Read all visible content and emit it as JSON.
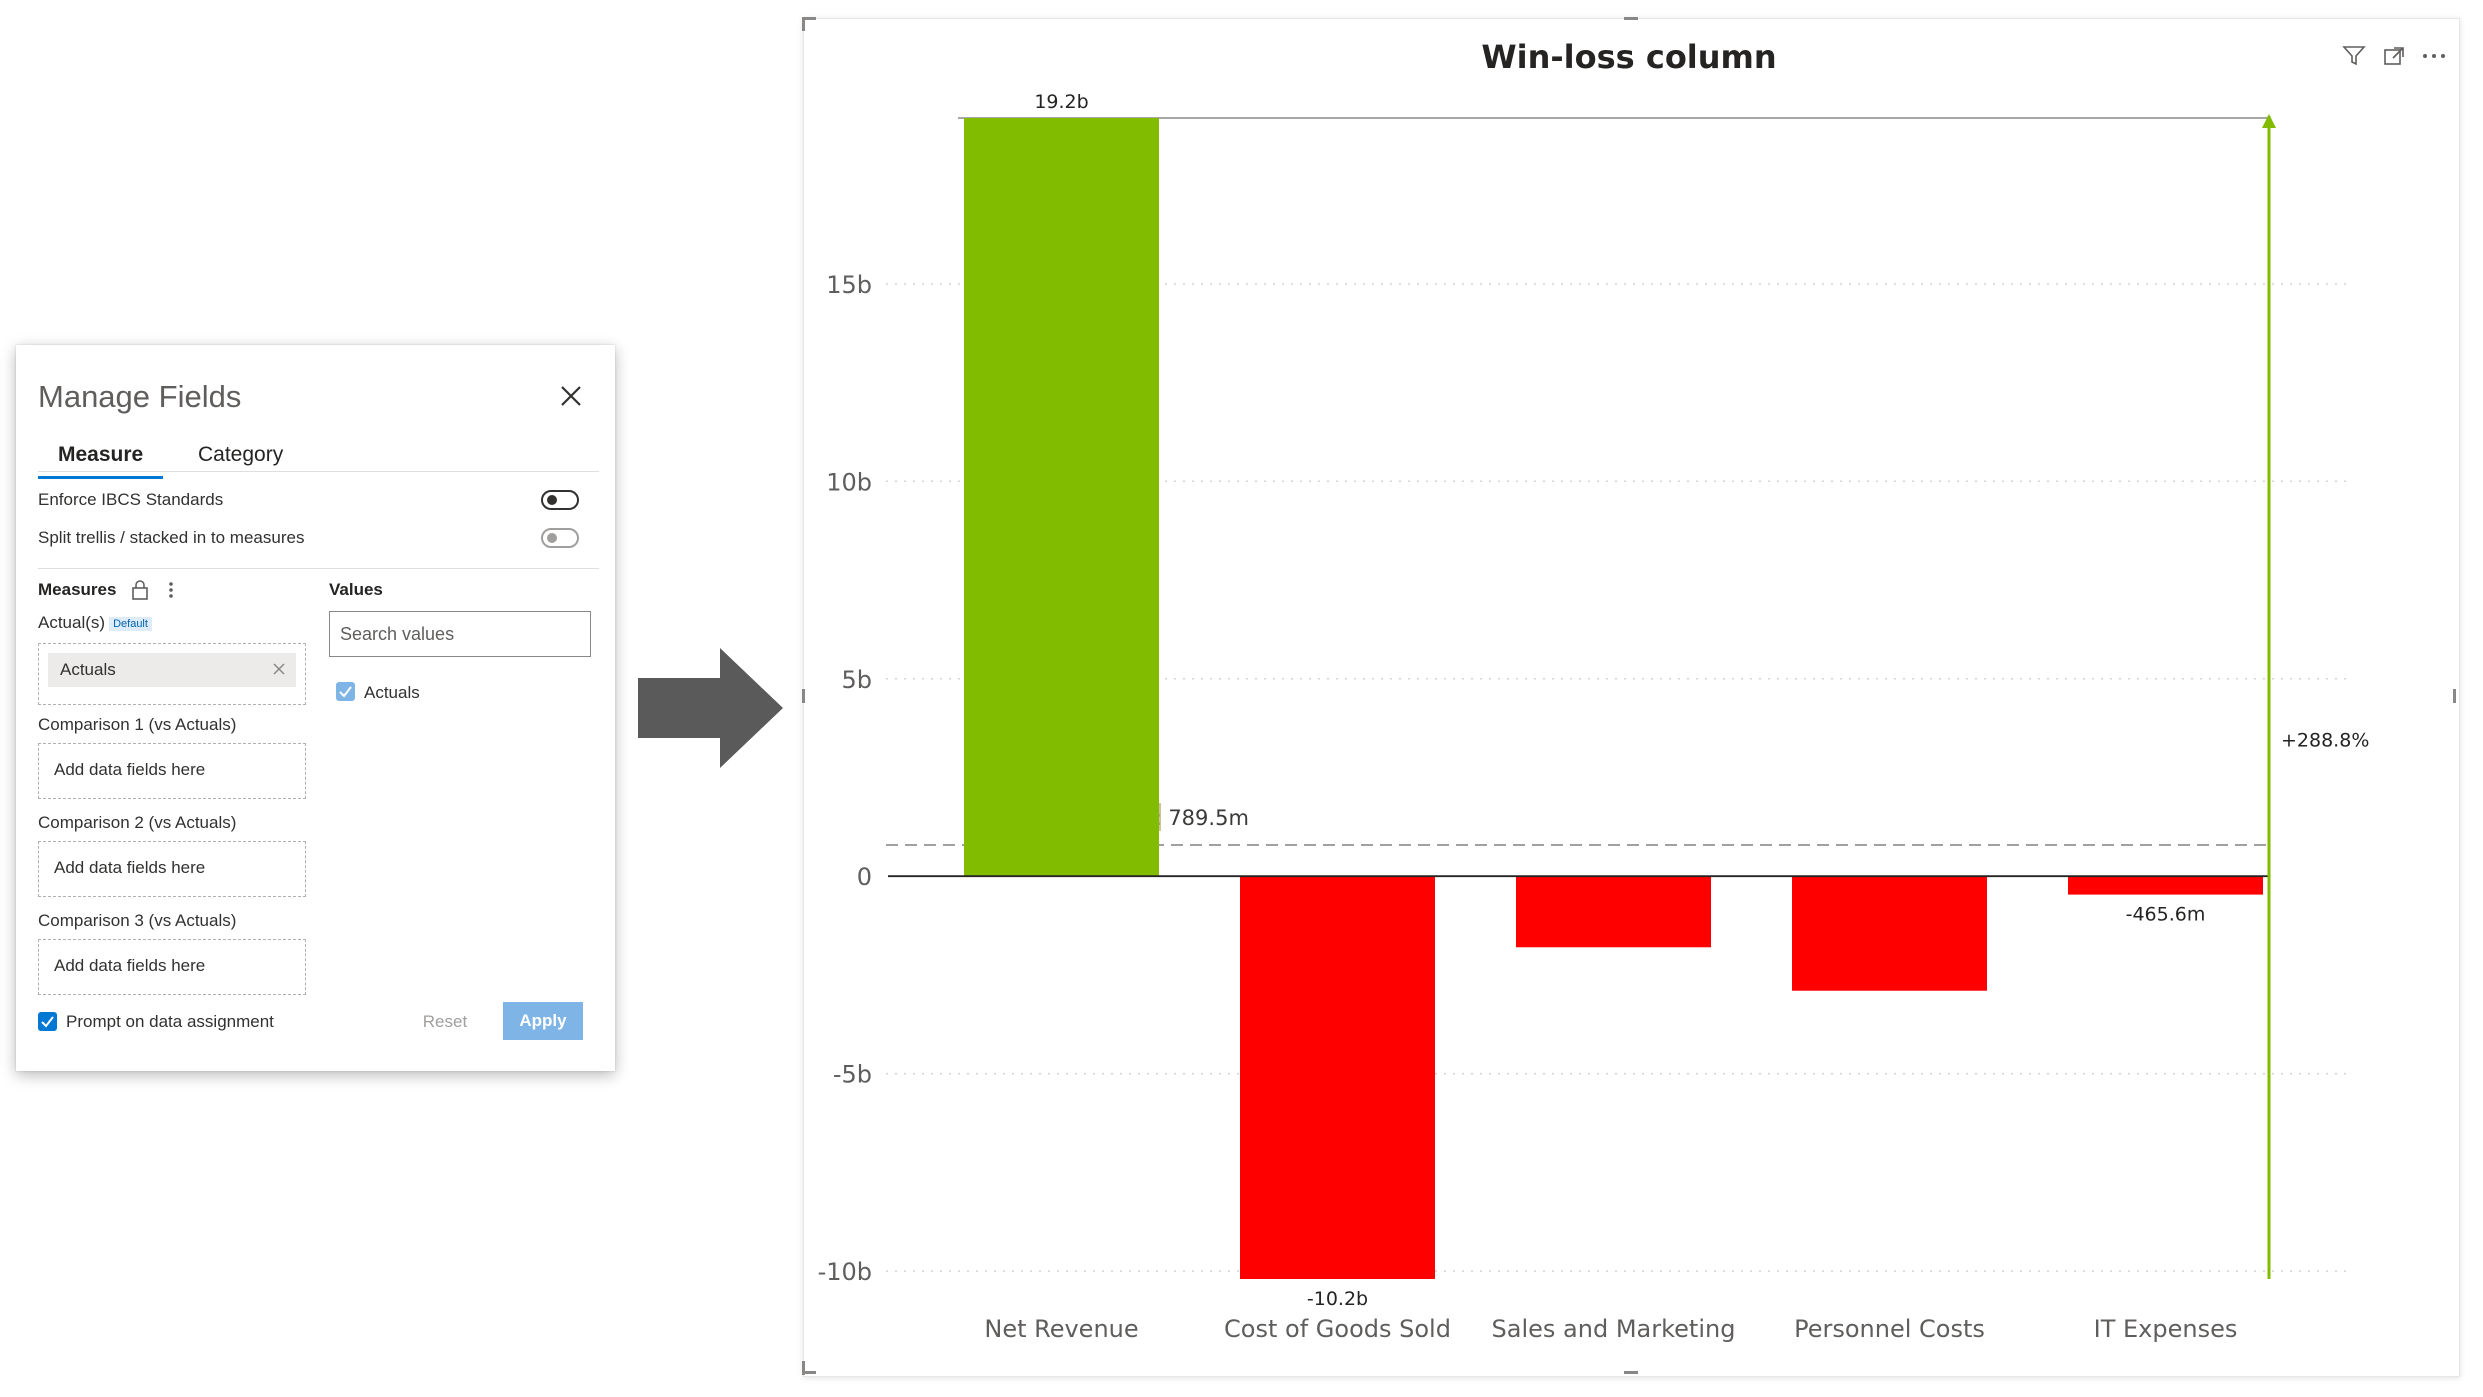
{
  "dialog": {
    "title": "Manage Fields",
    "tabs": [
      "Measure",
      "Category"
    ],
    "enforce_label": "Enforce IBCS Standards",
    "split_label": "Split trellis / stacked in to measures",
    "measures_heading": "Measures",
    "values_heading": "Values",
    "actuals_label": "Actual(s)",
    "default_badge": "Default",
    "actuals_pill": "Actuals",
    "comparison1_label": "Comparison 1 (vs Actuals)",
    "comparison2_label": "Comparison 2 (vs Actuals)",
    "comparison3_label": "Comparison 3 (vs Actuals)",
    "add_fields_text": "Add data fields here",
    "search_placeholder": "Search values",
    "value_item": "Actuals",
    "prompt_label": "Prompt on data assignment",
    "reset_label": "Reset",
    "apply_label": "Apply"
  },
  "chart_data": {
    "type": "bar",
    "title": "Win-loss column",
    "categories": [
      "Net Revenue",
      "Cost of Goods Sold",
      "Sales and Marketing",
      "Personnel Costs",
      "IT Expenses"
    ],
    "values": [
      19.2,
      -10.2,
      -1.8,
      -2.9,
      -0.4656
    ],
    "data_labels": [
      "19.2b",
      "-10.2b",
      "",
      "",
      "-465.6m"
    ],
    "unit": "b",
    "yticks": [
      -10,
      -5,
      0,
      5,
      10,
      15
    ],
    "ytick_labels": [
      "-10b",
      "-5b",
      "0",
      "5b",
      "10b",
      "15b"
    ],
    "ylim": [
      -10.2,
      19.2
    ],
    "grid": true,
    "average": 0.7895,
    "average_label": "Avg : 789.5m",
    "variance_label": "+288.8%",
    "positive_color": "#82BC00",
    "negative_color": "#FF0000"
  }
}
